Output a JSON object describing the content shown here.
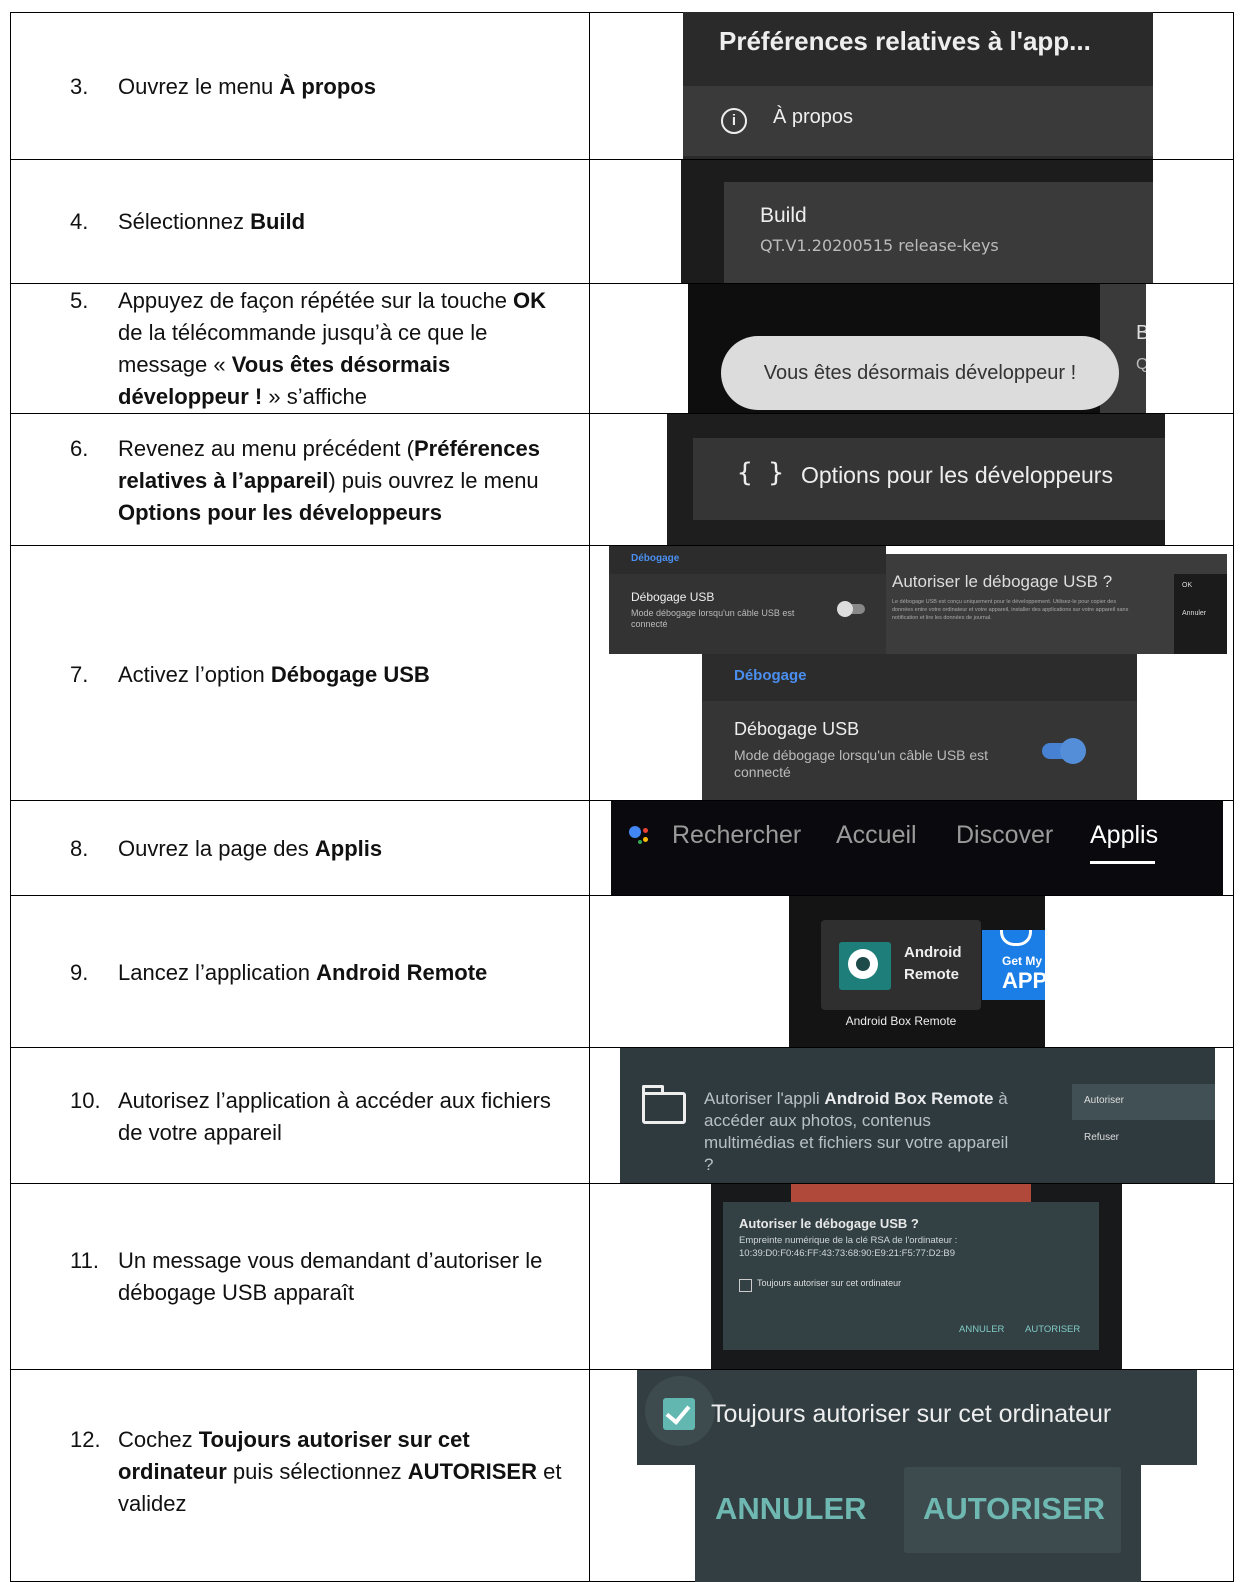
{
  "rows": [
    {
      "num": "3.",
      "parts": [
        {
          "t": "Ouvrez le menu "
        },
        {
          "t": "À propos",
          "b": true
        }
      ]
    },
    {
      "num": "4.",
      "parts": [
        {
          "t": "Sélectionnez "
        },
        {
          "t": "Build",
          "b": true
        }
      ]
    },
    {
      "num": "5.",
      "parts": [
        {
          "t": "Appuyez de façon répétée sur la touche "
        },
        {
          "t": "OK",
          "b": true
        },
        {
          "t": " de la télécommande jusqu’à ce que le message « "
        },
        {
          "t": "Vous êtes désormais développeur !",
          "b": true
        },
        {
          "t": " » s’affiche"
        }
      ]
    },
    {
      "num": "6.",
      "parts": [
        {
          "t": "Revenez au menu précédent ("
        },
        {
          "t": "Préférences relatives à l’appareil",
          "b": true
        },
        {
          "t": ") puis ouvrez le menu "
        },
        {
          "t": "Options pour les développeurs",
          "b": true
        }
      ]
    },
    {
      "num": "7.",
      "parts": [
        {
          "t": "Activez l’option "
        },
        {
          "t": "Débogage USB",
          "b": true
        }
      ]
    },
    {
      "num": "8.",
      "parts": [
        {
          "t": "Ouvrez la page des "
        },
        {
          "t": "Applis",
          "b": true
        }
      ]
    },
    {
      "num": "9.",
      "parts": [
        {
          "t": "Lancez l’application "
        },
        {
          "t": "Android Remote",
          "b": true
        }
      ]
    },
    {
      "num": "10.",
      "parts": [
        {
          "t": "Autorisez l’application à accéder aux fichiers de votre appareil"
        }
      ]
    },
    {
      "num": "11.",
      "parts": [
        {
          "t": "Un message vous demandant d’autoriser le débogage USB apparaît"
        }
      ]
    },
    {
      "num": "12.",
      "parts": [
        {
          "t": "Cochez "
        },
        {
          "t": "Toujours autoriser sur cet ordinateur",
          "b": true
        },
        {
          "t": " puis sélectionnez "
        },
        {
          "t": "AUTORISER",
          "b": true
        },
        {
          "t": " et validez"
        }
      ]
    }
  ],
  "shots": {
    "s3": {
      "title": "Préférences relatives à l'app...",
      "item": "À propos"
    },
    "s4": {
      "title": "Build",
      "sub": "QT.V1.20200515 release-keys",
      "edge1": "B",
      "edge2": "Q"
    },
    "s5": {
      "toast": "Vous êtes désormais développeur !"
    },
    "s6": {
      "braces": "{ }",
      "label": "Options pour les développeurs"
    },
    "s7": {
      "small_section": "Débogage",
      "small_title": "Débogage USB",
      "small_sub": "Mode débogage lorsqu'un câble USB est connecté",
      "dialog_title": "Autoriser le débogage USB ?",
      "dialog_body": "Le débogage USB est conçu uniquement pour le développement. Utilisez-le pour copier des données entre votre ordinateur et votre appareil, installer des applications sur votre appareil sans notification et lire les données de journal.",
      "ok": "OK",
      "cancel": "Annuler",
      "section": "Débogage",
      "title": "Débogage USB",
      "sub": "Mode débogage lorsqu'un câble USB est connecté"
    },
    "s8": {
      "tabs": [
        "Rechercher",
        "Accueil",
        "Discover",
        "Applis"
      ],
      "active": "Applis"
    },
    "s9": {
      "app_line1": "Android",
      "app_line2": "Remote",
      "caption": "Android Box Remote",
      "next_line1": "Get My",
      "next_line2": "APP"
    },
    "s10": {
      "pre": "Autoriser l'appli ",
      "app": "Android Box Remote",
      "post": " à accéder aux photos, contenus multimédias et fichiers sur votre appareil ?",
      "allow": "Autoriser",
      "deny": "Refuser"
    },
    "s11": {
      "title": "Autoriser le débogage USB ?",
      "line1": "Empreinte numérique de la clé RSA de l'ordinateur :",
      "line2": "10:39:D0:F0:46:FF:43:73:68:90:E9:21:F5:77:D2:B9",
      "checkbox": "Toujours autoriser sur cet ordinateur",
      "cancel": "ANNULER",
      "allow": "AUTORISER"
    },
    "s12": {
      "checkbox": "Toujours autoriser sur cet ordinateur",
      "cancel": "ANNULER",
      "allow": "AUTORISER"
    }
  },
  "colors": {
    "tv_dark": "#262626",
    "tv_panel": "#333333",
    "accent_blue": "#4a8ff0",
    "teal": "#80cbc4",
    "checkbox_teal": "#62b8b0"
  }
}
